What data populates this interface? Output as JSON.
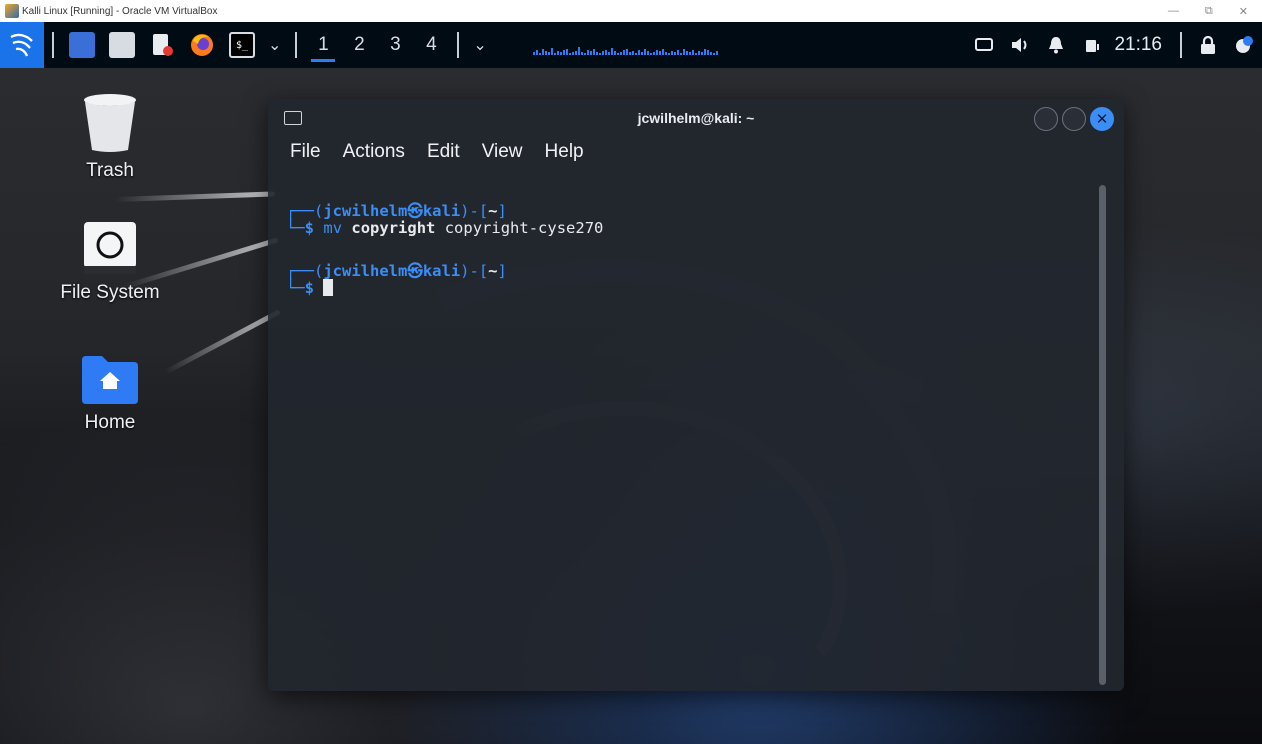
{
  "host": {
    "title": "Kalli Linux [Running] - Oracle VM VirtualBox",
    "controls": [
      "—",
      "⧉",
      "✕"
    ]
  },
  "panel": {
    "workspaces": [
      "1",
      "2",
      "3",
      "4"
    ],
    "active_workspace": "1",
    "clock": "21:16",
    "icons": {
      "menu": "kali-menu-icon",
      "launchers": [
        "show-desktop-icon",
        "file-manager-icon",
        "text-editor-icon",
        "firefox-icon",
        "terminal-icon"
      ],
      "tray": [
        "network-icon",
        "volume-icon",
        "notifications-icon",
        "battery-icon",
        "lock-screen-icon",
        "power-icon"
      ]
    },
    "accent": "#2f7bf5"
  },
  "desktop": {
    "icons": [
      {
        "label": "Trash",
        "icon": "trash-icon"
      },
      {
        "label": "File System",
        "icon": "drive-icon"
      },
      {
        "label": "Home",
        "icon": "home-folder-icon"
      }
    ]
  },
  "terminal": {
    "title": "jcwilhelm@kali: ~",
    "menu": [
      "File",
      "Actions",
      "Edit",
      "View",
      "Help"
    ],
    "prompt_user": "jcwilhelm",
    "prompt_at": "㉿",
    "prompt_host": "kali",
    "prompt_dir": "~",
    "command_verb": "mv",
    "command_arg1": "copyright",
    "command_arg2": "copyright-cyse270",
    "prompt_symbol": "$"
  }
}
